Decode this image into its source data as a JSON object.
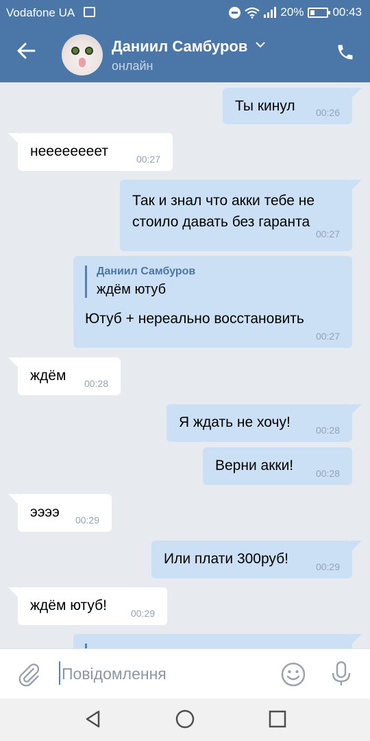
{
  "status_bar": {
    "carrier": "Vodafone UA",
    "battery": "20%",
    "time": "00:43",
    "icons": [
      "image-icon",
      "dnd-icon",
      "wifi-icon",
      "signal-icon",
      "battery-icon"
    ]
  },
  "header": {
    "contact_name": "Даниил Самбуров",
    "status": "онлайн",
    "icons": [
      "back-arrow-icon",
      "chevron-down-icon",
      "phone-icon"
    ]
  },
  "messages": [
    {
      "dir": "out",
      "text": "Ты кинул",
      "time": "00:26"
    },
    {
      "dir": "in",
      "text": "неееееееет",
      "time": "00:27"
    },
    {
      "dir": "out",
      "text_line1": "Так и знал что акки тебе не",
      "text_line2": "стоило давать без гаранта",
      "time": "00:27"
    },
    {
      "dir": "out",
      "reply_name": "Даниил Самбуров",
      "reply_text": "ждём ютуб",
      "text": "Ютуб + нереально восстановить",
      "time": "00:27"
    },
    {
      "dir": "in",
      "text": "ждём",
      "time": "00:28"
    },
    {
      "dir": "out",
      "text": "Я ждать не хочу!",
      "time": "00:28"
    },
    {
      "dir": "out",
      "text": "Верни акки!",
      "time": "00:28"
    },
    {
      "dir": "in",
      "text": "ээээ",
      "time": "00:29"
    },
    {
      "dir": "out",
      "text": "Или плати 300руб!",
      "time": "00:29"
    },
    {
      "dir": "in",
      "text": "ждём ютуб!",
      "time": "00:29"
    }
  ],
  "composer": {
    "placeholder": "Повідомлення",
    "icons": [
      "attach-icon",
      "emoji-icon",
      "microphone-icon"
    ]
  },
  "nav": {
    "icons": [
      "back-nav-icon",
      "home-nav-icon",
      "recents-nav-icon"
    ]
  },
  "colors": {
    "header": "#4a76a8",
    "outgoing_bubble": "#cce0f5",
    "incoming_bubble": "#ffffff",
    "background": "#e7ebf0"
  }
}
